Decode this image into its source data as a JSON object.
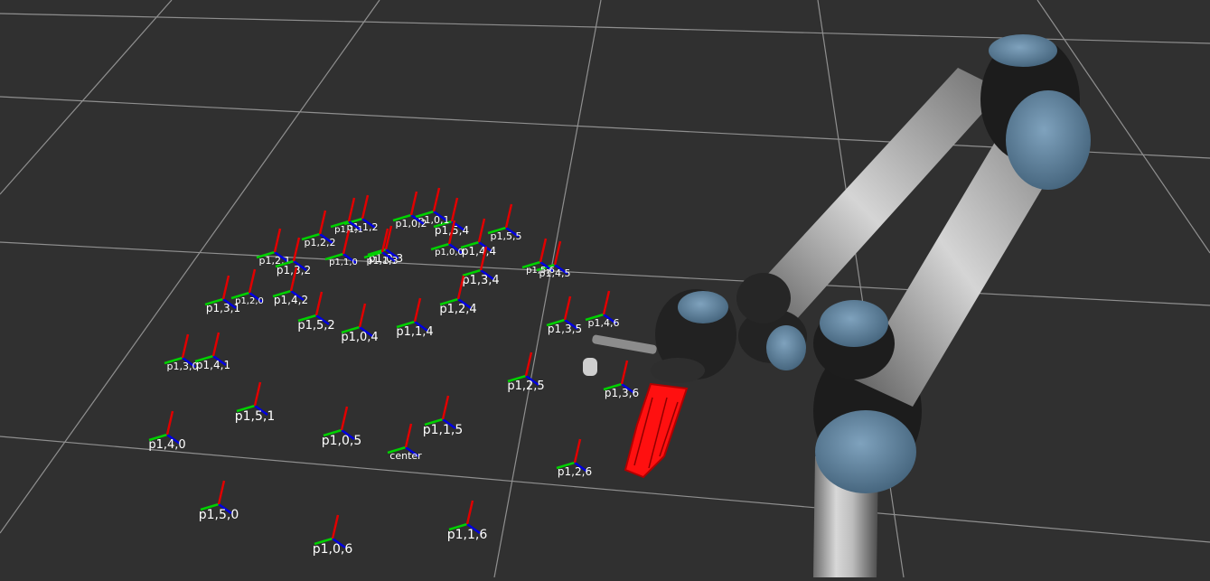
{
  "scene": {
    "background_color": "#303030",
    "grid_color": "#a0a0a0",
    "axis_colors": {
      "x": "#e00000",
      "y": "#00d000",
      "z": "#0000e0"
    },
    "gripper_color": "#ff1010",
    "arm_joint_cap_color": "#5d7f9a"
  },
  "frames": [
    {
      "label": "p1,3,6"
    },
    {
      "label": "p1,2,6"
    },
    {
      "label": "p1,4,6"
    },
    {
      "label": "p1,3,5"
    },
    {
      "label": "p1,2,5"
    },
    {
      "label": "p1,5,5"
    },
    {
      "label": "p1,4,5"
    },
    {
      "label": "p1,5,6"
    },
    {
      "label": "p1,4,4"
    },
    {
      "label": "p1,3,4"
    },
    {
      "label": "p1,2,4"
    },
    {
      "label": "p1,5,4"
    },
    {
      "label": "p1,0,1"
    },
    {
      "label": "p1,0,2"
    },
    {
      "label": "p1,0,0"
    },
    {
      "label": "p1,0,3"
    },
    {
      "label": "p1,1,3"
    },
    {
      "label": "p1,1,2"
    },
    {
      "label": "p1,1,1"
    },
    {
      "label": "p1,1,0"
    },
    {
      "label": "p1,2,2"
    },
    {
      "label": "p1,2,1"
    },
    {
      "label": "p1,3,2"
    },
    {
      "label": "p1,2,0"
    },
    {
      "label": "p1,4,2"
    },
    {
      "label": "p1,3,1"
    },
    {
      "label": "p1,5,2"
    },
    {
      "label": "p1,0,4"
    },
    {
      "label": "p1,1,4"
    },
    {
      "label": "p1,3,0"
    },
    {
      "label": "p1,4,1"
    },
    {
      "label": "p1,5,1"
    },
    {
      "label": "p1,0,5"
    },
    {
      "label": "p1,1,5"
    },
    {
      "label": "center"
    },
    {
      "label": "p1,4,0"
    },
    {
      "label": "p1,5,0"
    },
    {
      "label": "p1,0,6"
    },
    {
      "label": "p1,1,6"
    }
  ]
}
